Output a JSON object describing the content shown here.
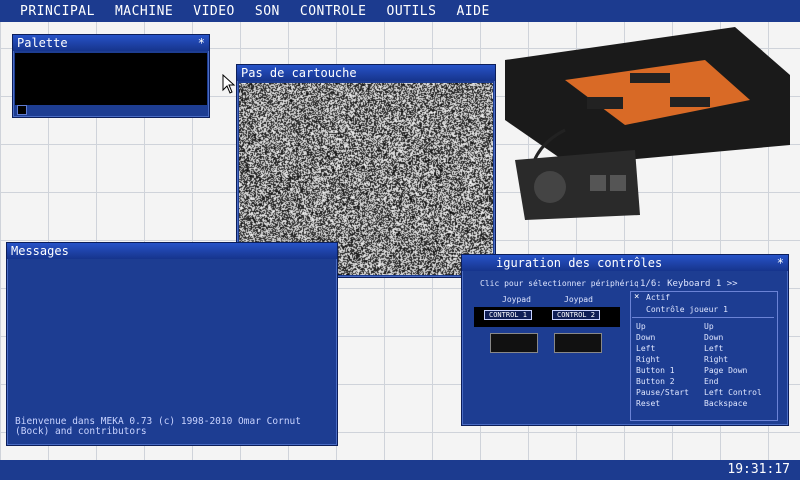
{
  "menu": [
    "PRINCIPAL",
    "MACHINE",
    "VIDEO",
    "SON",
    "CONTROLE",
    "OUTILS",
    "AIDE"
  ],
  "clock": "19:31:17",
  "palette": {
    "title": "Palette"
  },
  "cartridge": {
    "title": "Pas de cartouche"
  },
  "messages": {
    "title": "Messages",
    "lines": [
      "Bienvenue dans MEKA 0.73 (c) 1998-2010 Omar Cornut",
      "(Bock) and contributors"
    ]
  },
  "controls": {
    "title": "iguration des contrôles",
    "hint": "Clic pour sélectionner périphérique",
    "joypad1": "Joypad",
    "joypad2": "Joypad",
    "control1": "CONTROL 1",
    "control2": "CONTROL 2",
    "device": "1/6: Keyboard 1 >>",
    "active": "Actif",
    "player": "Contrôle joueur 1",
    "labels": [
      "Up",
      "Down",
      "Left",
      "Right",
      "Button 1",
      "Button 2",
      "Pause/Start",
      "Reset"
    ],
    "keys": [
      "Up",
      "Down",
      "Left",
      "Right",
      "Page Down",
      "End",
      "Left Control",
      "Backspace"
    ]
  },
  "colors": {
    "accent": "#1d3d92",
    "menubar": "#1c3b8f"
  }
}
